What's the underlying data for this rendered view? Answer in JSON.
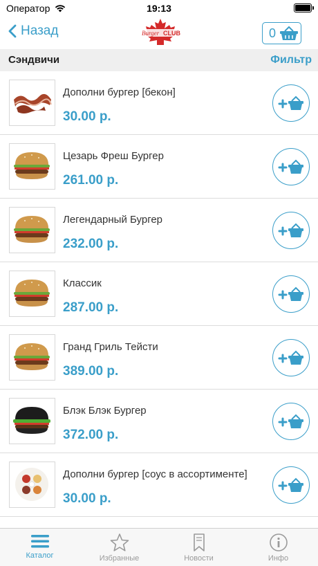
{
  "status": {
    "carrier": "Оператор",
    "time": "19:13"
  },
  "nav": {
    "back_label": "Назад",
    "cart_count": "0",
    "logo_text_left": "Burger",
    "logo_text_right": "CLUB"
  },
  "section": {
    "title": "Сэндвичи",
    "filter_label": "Фильтр"
  },
  "items": [
    {
      "name": "Дополни бургер [бекон]",
      "price": "30.00 р.",
      "image": "bacon"
    },
    {
      "name": "Цезарь Фреш Бургер",
      "price": "261.00 р.",
      "image": "burger"
    },
    {
      "name": "Легендарный Бургер",
      "price": "232.00 р.",
      "image": "burger"
    },
    {
      "name": "Классик",
      "price": "287.00 р.",
      "image": "burger"
    },
    {
      "name": "Гранд Гриль Тейсти",
      "price": "389.00 р.",
      "image": "burger"
    },
    {
      "name": "Блэк Блэк Бургер",
      "price": "372.00 р.",
      "image": "black-burger"
    },
    {
      "name": "Дополни бургер [соус в ассортименте]",
      "price": "30.00 р.",
      "image": "sauces"
    }
  ],
  "tabs": [
    {
      "label": "Каталог",
      "icon": "menu-icon",
      "active": true
    },
    {
      "label": "Избранные",
      "icon": "star-icon",
      "active": false
    },
    {
      "label": "Новости",
      "icon": "bookmark-icon",
      "active": false
    },
    {
      "label": "Инфо",
      "icon": "info-icon",
      "active": false
    }
  ],
  "colors": {
    "accent": "#3a9ec9",
    "logo_red": "#d42a2a",
    "section_bg": "#efefef"
  }
}
